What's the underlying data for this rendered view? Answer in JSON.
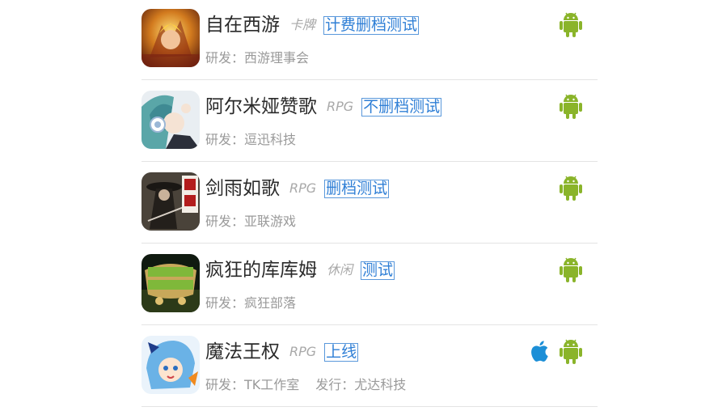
{
  "colors": {
    "android": "#8ab42a",
    "apple": "#1c8fd7",
    "badge": "#2f7fd6",
    "title": "#2a2a2a",
    "meta": "#9a9a9a",
    "divider": "#e4e4e4"
  },
  "games": [
    {
      "name": "自在西游",
      "genre": "卡牌",
      "badge": "计费删档测试",
      "developer": "研发：西游理事会",
      "publisher": "",
      "platforms": [
        "android-icon"
      ]
    },
    {
      "name": "阿尔米娅赞歌",
      "genre": "RPG",
      "badge": "不删档测试",
      "developer": "研发：逗迅科技",
      "publisher": "",
      "platforms": [
        "android-icon"
      ]
    },
    {
      "name": "剑雨如歌",
      "genre": "RPG",
      "badge": "删档测试",
      "developer": "研发：亚联游戏",
      "publisher": "",
      "platforms": [
        "android-icon"
      ]
    },
    {
      "name": "疯狂的库库姆",
      "genre": "休闲",
      "badge": "测试",
      "developer": "研发：疯狂部落",
      "publisher": "",
      "platforms": [
        "android-icon"
      ]
    },
    {
      "name": "魔法王权",
      "genre": "RPG",
      "badge": "上线",
      "developer": "研发：TK工作室",
      "publisher": "发行：尤达科技",
      "platforms": [
        "apple-icon",
        "android-icon"
      ]
    }
  ]
}
